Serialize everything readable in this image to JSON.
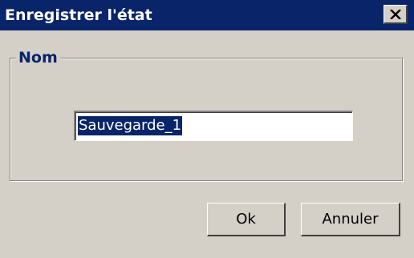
{
  "window": {
    "title": "Enregistrer l'état",
    "close_icon": "close-icon"
  },
  "group": {
    "legend": "Nom"
  },
  "name_field": {
    "value": "Sauvegarde_1"
  },
  "buttons": {
    "ok_label": "Ok",
    "cancel_label": "Annuler"
  },
  "colors": {
    "titlebar": "#0a246a",
    "face": "#d4d0c8",
    "legend_text": "#0a246a",
    "selection": "#0a246a"
  }
}
